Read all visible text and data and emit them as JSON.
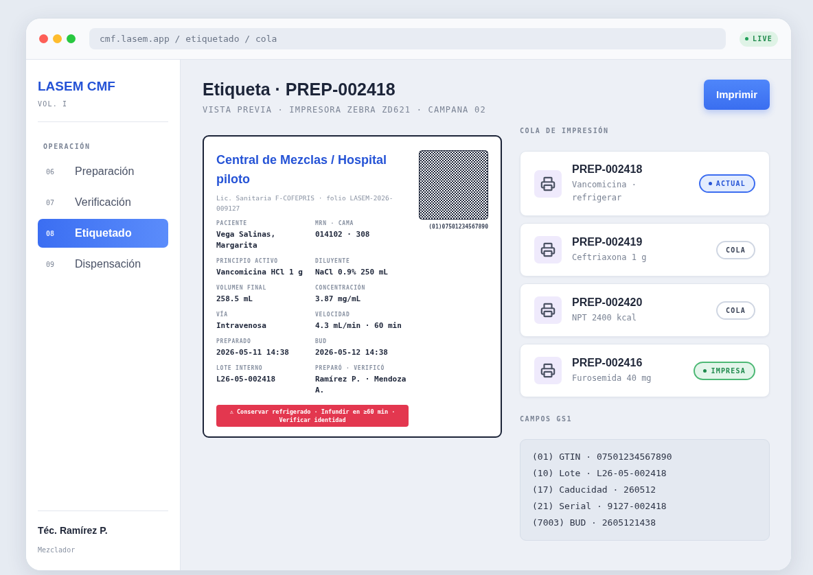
{
  "window": {
    "url": "cmf.lasem.app / etiquetado / cola",
    "live_badge": "LIVE"
  },
  "sidebar": {
    "brand": "LASEM CMF",
    "subtitle": "VOL. I",
    "section": "OPERACIÓN",
    "items": [
      {
        "number": "06",
        "label": "Preparación",
        "selected": false
      },
      {
        "number": "07",
        "label": "Verificación",
        "selected": false
      },
      {
        "number": "08",
        "label": "Etiquetado",
        "selected": true
      },
      {
        "number": "09",
        "label": "Dispensación",
        "selected": false
      }
    ],
    "user": {
      "name": "Téc. Ramírez P.",
      "role": "Mezclador"
    }
  },
  "header": {
    "title": "Etiqueta · PREP-002418",
    "subtitle": "VISTA PREVIA · IMPRESORA ZEBRA ZD621 · CAMPANA 02",
    "print_button": "Imprimir"
  },
  "label": {
    "title": "Central de Mezclas / Hospital piloto",
    "license": "Lic. Sanitaria F-COFEPRIS · folio LASEM-2026-009127",
    "barcode_text": "(01)07501234567890",
    "fields": [
      {
        "label": "PACIENTE",
        "value": "Vega Salinas, Margarita"
      },
      {
        "label": "MRN · CAMA",
        "value": "014102 · 308"
      },
      {
        "label": "PRINCIPIO ACTIVO",
        "value": "Vancomicina HCl 1 g"
      },
      {
        "label": "DILUYENTE",
        "value": "NaCl 0.9% 250 mL"
      },
      {
        "label": "VOLUMEN FINAL",
        "value": "258.5 mL"
      },
      {
        "label": "CONCENTRACIÓN",
        "value": "3.87 mg/mL"
      },
      {
        "label": "VÍA",
        "value": "Intravenosa"
      },
      {
        "label": "VELOCIDAD",
        "value": "4.3 mL/min · 60 min"
      },
      {
        "label": "PREPARADO",
        "value": "2026-05-11 14:38"
      },
      {
        "label": "BUD",
        "value": "2026-05-12 14:38"
      },
      {
        "label": "LOTE INTERNO",
        "value": "L26-05-002418"
      },
      {
        "label": "PREPARÓ · VERIFICÓ",
        "value": "Ramírez P. · Mendoza A."
      }
    ],
    "warning": "⚠ Conservar refrigerado · Infundir en ≥60 min · Verificar identidad"
  },
  "queue": {
    "heading": "COLA DE IMPRESIÓN",
    "items": [
      {
        "id": "PREP-002418",
        "description": "Vancomicina · refrigerar",
        "status": {
          "kind": "current",
          "label": "ACTUAL"
        }
      },
      {
        "id": "PREP-002419",
        "description": "Ceftriaxona 1 g",
        "status": {
          "kind": "queued",
          "label": "COLA"
        }
      },
      {
        "id": "PREP-002420",
        "description": "NPT 2400 kcal",
        "status": {
          "kind": "queued",
          "label": "COLA"
        }
      },
      {
        "id": "PREP-002416",
        "description": "Furosemida 40 mg",
        "status": {
          "kind": "printed",
          "label": "IMPRESA"
        }
      }
    ]
  },
  "gs1": {
    "heading": "CAMPOS GS1",
    "lines": [
      "(01) GTIN · 07501234567890",
      "(10) Lote · L26-05-002418",
      "(17) Caducidad · 260512",
      "(21) Serial · 9127-002418",
      "(7003) BUD · 2605121438"
    ]
  }
}
